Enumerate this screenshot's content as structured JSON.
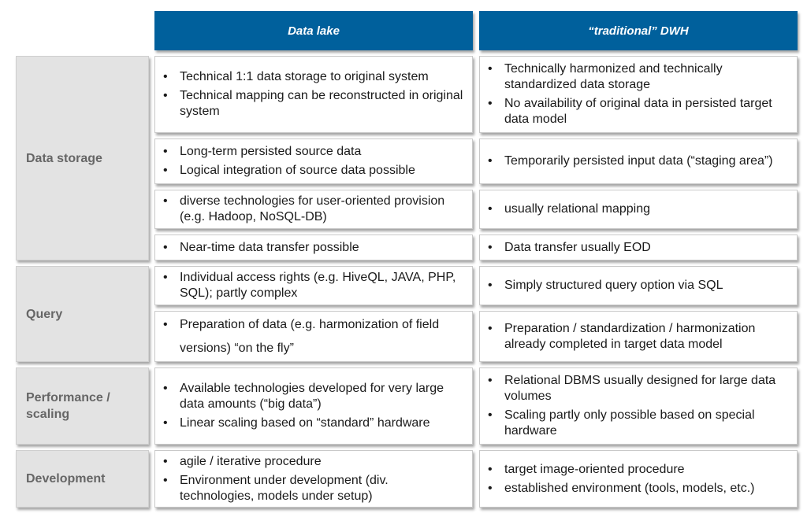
{
  "headers": {
    "data_lake": "Data lake",
    "dwh": "“traditional” DWH"
  },
  "categories": {
    "data_storage": "Data storage",
    "query": "Query",
    "performance": "Performance / scaling",
    "development": "Development"
  },
  "bullet_glyph": "•",
  "rows": [
    {
      "data_lake": [
        "Technical 1:1 data storage to original system",
        "Technical mapping can be reconstructed in original system"
      ],
      "dwh": [
        "Technically harmonized and technically standardized data storage",
        "No availability of original data in persisted target data model"
      ]
    },
    {
      "data_lake": [
        "Long-term persisted source data",
        "Logical integration of source data possible"
      ],
      "dwh": [
        "Temporarily persisted input data (“staging area”)"
      ]
    },
    {
      "data_lake": [
        "diverse technologies for user-oriented provision (e.g. Hadoop, NoSQL-DB)"
      ],
      "dwh": [
        "usually relational mapping"
      ]
    },
    {
      "data_lake": [
        "Near-time data transfer possible"
      ],
      "dwh": [
        "Data transfer usually EOD"
      ]
    },
    {
      "data_lake": [
        "Individual access rights (e.g. HiveQL, JAVA, PHP, SQL); partly complex"
      ],
      "dwh": [
        "Simply structured query option via SQL"
      ]
    },
    {
      "data_lake": [
        "Preparation of data (e.g. harmonization of field versions) “on the  fly”"
      ],
      "dwh": [
        "Preparation / standardization / harmonization already completed in target data model"
      ]
    },
    {
      "data_lake": [
        "Available technologies developed for very large data amounts (“big data”)",
        "Linear scaling based on “standard” hardware"
      ],
      "dwh": [
        "Relational DBMS usually designed for large data volumes",
        "Scaling partly only possible based on special hardware"
      ]
    },
    {
      "data_lake": [
        "agile / iterative procedure",
        "Environment under development (div. technologies, models under setup)"
      ],
      "dwh": [
        "target image-oriented procedure",
        "established environment (tools, models, etc.)"
      ]
    }
  ]
}
